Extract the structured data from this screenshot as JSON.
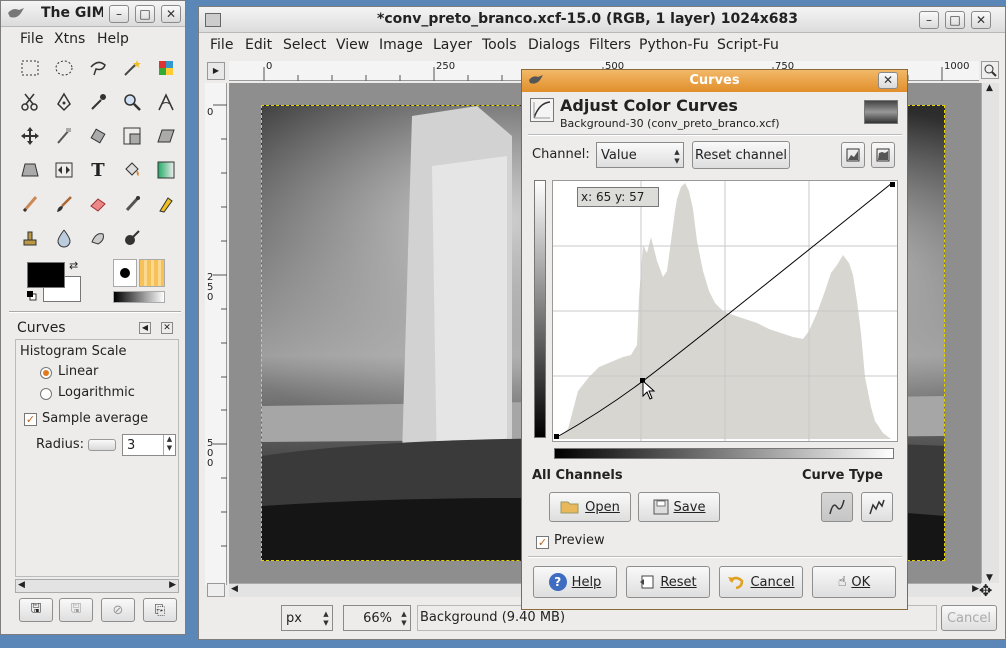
{
  "toolbox": {
    "title": "The GIMP",
    "menu": [
      "File",
      "Xtns",
      "Help"
    ],
    "panel": {
      "title": "Curves",
      "histogram_scale_label": "Histogram Scale",
      "linear_label": "Linear",
      "logarithmic_label": "Logarithmic",
      "sample_average_label": "Sample average",
      "radius_label": "Radius:",
      "radius_value": "3"
    }
  },
  "image_window": {
    "title": "*conv_preto_branco.xcf-15.0 (RGB, 1 layer) 1024x683",
    "menu": [
      "File",
      "Edit",
      "Select",
      "View",
      "Image",
      "Layer",
      "Tools",
      "Dialogs",
      "Filters",
      "Python-Fu",
      "Script-Fu"
    ],
    "ruler_h": [
      "0",
      "250",
      "500",
      "750",
      "1000"
    ],
    "ruler_v": [
      "0",
      "2\n5\n0",
      "5\n0\n0"
    ],
    "unit": "px",
    "zoom": "66%",
    "status": "Background (9.40 MB)",
    "cancel_label": "Cancel"
  },
  "curves_dialog": {
    "title": "Curves",
    "heading": "Adjust Color Curves",
    "subheading": "Background-30 (conv_preto_branco.xcf)",
    "channel_label": "Channel:",
    "channel_value": "Value",
    "reset_channel_label": "Reset channel",
    "coords_readout": "x: 65 y: 57",
    "all_channels_label": "All Channels",
    "curve_type_label": "Curve Type",
    "open_label": "Open",
    "save_label": "Save",
    "preview_label": "Preview",
    "help_label": "Help",
    "reset_label": "Reset",
    "cancel_label": "Cancel",
    "ok_label": "OK"
  },
  "colors": {
    "accent": "#e07b1f",
    "dialog_title_bar": "#e8a24a",
    "histogram_fill": "#d8d6d1"
  }
}
